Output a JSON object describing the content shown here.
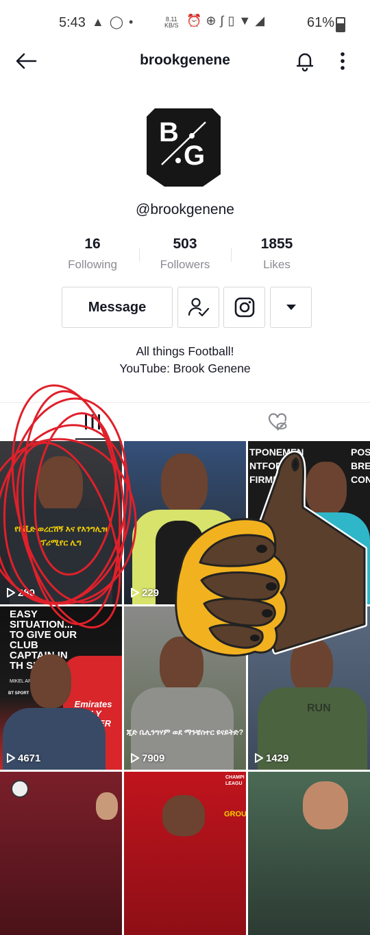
{
  "status_bar": {
    "time": "5:43",
    "speed_value": "8.11",
    "speed_unit": "KB/S",
    "battery": "61%"
  },
  "header": {
    "title": "brookgenene"
  },
  "profile": {
    "avatar_letters": [
      "B",
      "G"
    ],
    "handle": "@brookgenene",
    "stats": [
      {
        "value": "16",
        "label": "Following"
      },
      {
        "value": "503",
        "label": "Followers"
      },
      {
        "value": "1855",
        "label": "Likes"
      }
    ],
    "message_label": "Message",
    "bio_line1": "All things Football!",
    "bio_line2": "YouTube: Brook Genene"
  },
  "videos": [
    {
      "views": "280",
      "caption": "የኮቪድ ወረርሽኝ እና የእንግሊዝ ፕሪሚየር ሊግ"
    },
    {
      "views": "229"
    },
    {
      "views": "",
      "headline_left": "TPONEMEN",
      "headline_left2": "NTFORD",
      "headline_left3": "FIRME",
      "headline_right": "POS",
      "headline_right2": "BRE",
      "headline_right3": "CON"
    },
    {
      "views": "4671",
      "headline": "EASY SITUATION... TO GIVE OUR CLUB CAPTAIN IN TH SITUA",
      "caption_small": "MIKEL ARTE",
      "badge": "BT SPORT",
      "shirt": "Emirates FLY BETTER"
    },
    {
      "views": "7909",
      "caption": "ጂድ ቤሊንግሃም ወደ ማንቼስተር ዩናይትድ?"
    },
    {
      "views": "1429",
      "shirt": "RUN"
    },
    {
      "views": ""
    },
    {
      "views": "",
      "headline": "CHAMPI LEAGU",
      "caption": "GROU"
    },
    {
      "views": ""
    }
  ],
  "colors": {
    "text": "#161823",
    "muted": "#8a8b91",
    "border": "#d7d7d9",
    "scribble": "#e0202a",
    "sticker_skin": "#5a3f2c",
    "sticker_gold": "#f2b21f"
  }
}
